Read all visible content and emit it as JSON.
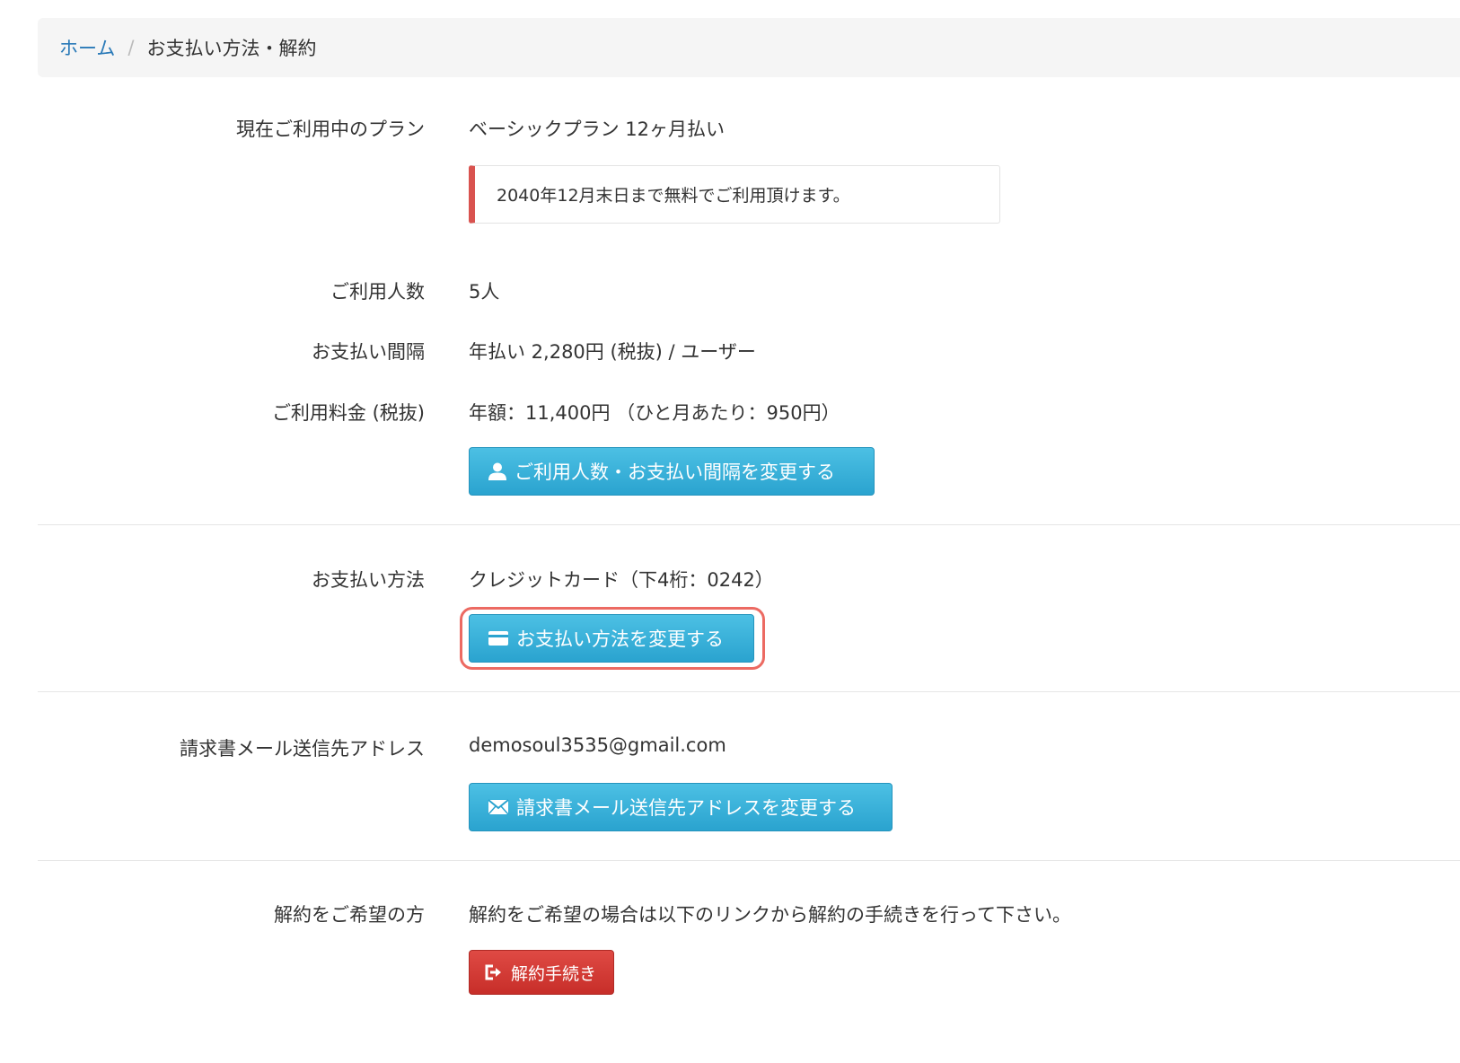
{
  "breadcrumb": {
    "home": "ホーム",
    "separator": "/",
    "current": "お支払い方法・解約"
  },
  "plan": {
    "label": "現在ご利用中のプラン",
    "value": "ベーシックプラン 12ヶ月払い",
    "notice": "2040年12月末日まで無料でご利用頂けます。"
  },
  "users": {
    "label": "ご利用人数",
    "value": "5人"
  },
  "interval": {
    "label": "お支払い間隔",
    "value": "年払い 2,280円 (税抜) / ユーザー"
  },
  "fee": {
    "label": "ご利用料金 (税抜)",
    "value": "年額：11,400円 （ひと月あたり：950円）"
  },
  "buttons": {
    "change_users": "ご利用人数・お支払い間隔を変更する",
    "change_payment": "お支払い方法を変更する",
    "change_email": "請求書メール送信先アドレスを変更する",
    "cancel": "解約手続き"
  },
  "payment": {
    "label": "お支払い方法",
    "value": "クレジットカード（下4桁：0242）"
  },
  "email": {
    "label": "請求書メール送信先アドレス",
    "value": "demosoul3535@gmail.com"
  },
  "cancellation": {
    "label": "解約をご希望の方",
    "value": "解約をご希望の場合は以下のリンクから解約の手続きを行って下さい。"
  },
  "colors": {
    "info_button": "#2aa3cf",
    "danger_button": "#c72e29",
    "link": "#2a7ab8",
    "notice_border": "#d9534f",
    "highlight": "#ec6a62"
  },
  "icons": {
    "change_users": "user-icon",
    "change_payment": "credit-card-icon",
    "change_email": "envelope-icon",
    "cancel": "log-out-icon"
  }
}
